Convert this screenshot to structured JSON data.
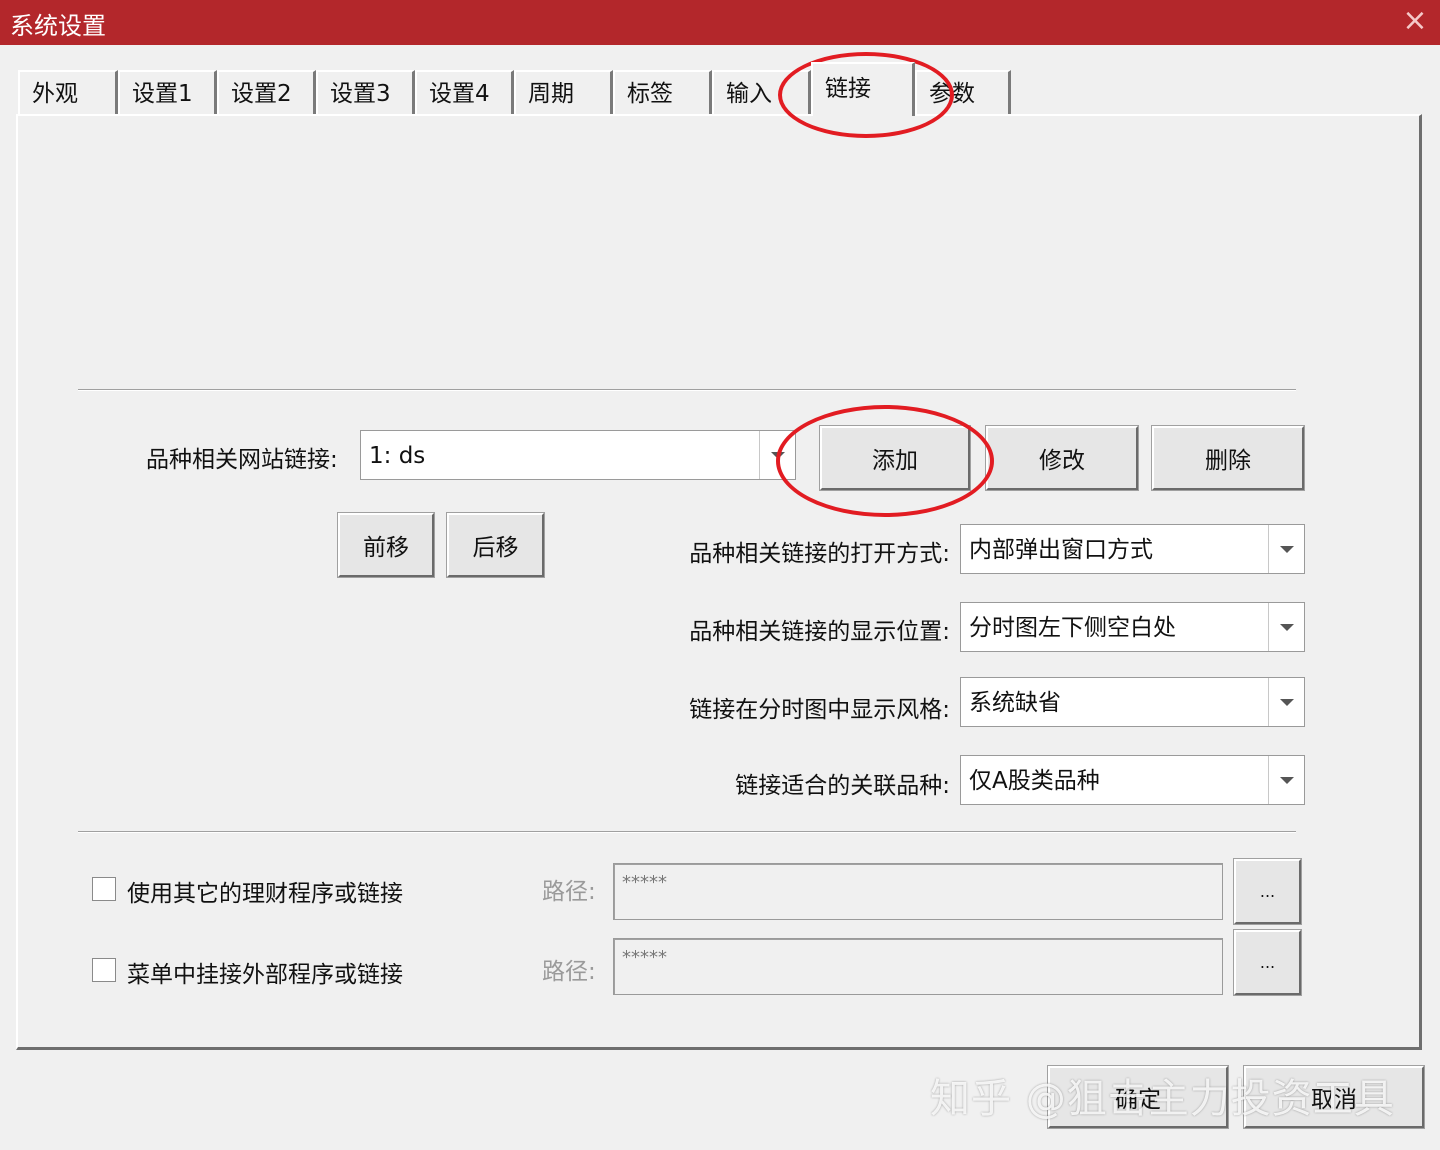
{
  "window": {
    "title": "系统设置",
    "close_icon": "×"
  },
  "tabs": [
    {
      "label": "外观"
    },
    {
      "label": "设置1"
    },
    {
      "label": "设置2"
    },
    {
      "label": "设置3"
    },
    {
      "label": "设置4"
    },
    {
      "label": "周期"
    },
    {
      "label": "标签"
    },
    {
      "label": "输入"
    },
    {
      "label": "链接",
      "active": true
    },
    {
      "label": "参数"
    }
  ],
  "links": {
    "site_link_label": "品种相关网站链接:",
    "site_link_value": "1: ds",
    "add_button": "添加",
    "modify_button": "修改",
    "delete_button": "删除",
    "move_up_button": "前移",
    "move_down_button": "后移",
    "open_mode_label": "品种相关链接的打开方式:",
    "open_mode_value": "内部弹出窗口方式",
    "display_position_label": "品种相关链接的显示位置:",
    "display_position_value": "分时图左下侧空白处",
    "display_style_label": "链接在分时图中显示风格:",
    "display_style_value": "系统缺省",
    "applicable_label": "链接适合的关联品种:",
    "applicable_value": "仅A股类品种"
  },
  "external": {
    "use_other_program_label": "使用其它的理财程序或链接",
    "use_other_program_checked": false,
    "menu_external_label": "菜单中挂接外部程序或链接",
    "menu_external_checked": false,
    "path_label": "路径:",
    "path_value_1": "*****",
    "path_value_2": "*****",
    "browse_label": "..."
  },
  "footer": {
    "ok_button": "确定",
    "cancel_button": "取消"
  },
  "watermark": "知乎 @狙击主力投资工具",
  "colors": {
    "titlebar": "#b3272b",
    "highlight": "#e21c22"
  }
}
